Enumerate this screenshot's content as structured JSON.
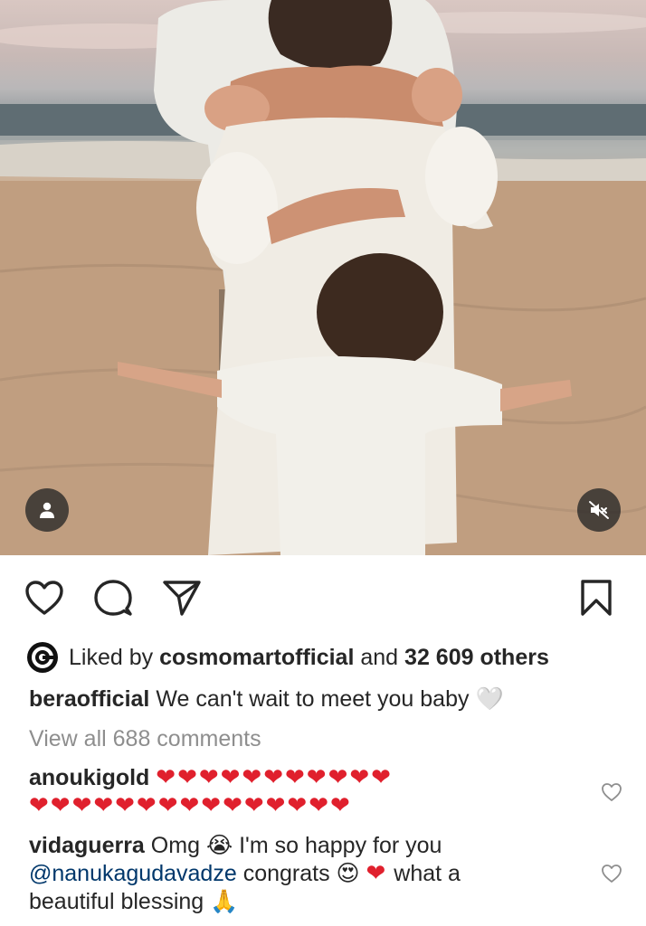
{
  "post": {
    "media_description": "",
    "user_tag_icon": "person-icon",
    "mute_icon": "speaker-muted-icon"
  },
  "actions": {
    "like_icon": "heart-outline-icon",
    "comment_icon": "speech-bubble-icon",
    "share_icon": "paper-plane-icon",
    "save_icon": "bookmark-icon"
  },
  "likes": {
    "prefix": "Liked by",
    "liker": "cosmomartofficial",
    "joiner": "and",
    "others": "32 609 others"
  },
  "caption": {
    "username": "beraofficial",
    "text": "We can't wait to meet you baby",
    "emoji": "🤍"
  },
  "view_all_comments": "View all 688 comments",
  "comments": [
    {
      "username": "anoukigold",
      "line1_hearts": "❤❤❤❤❤❤❤❤❤❤❤",
      "line2_hearts": "❤❤❤❤❤❤❤❤❤❤❤❤❤❤❤"
    },
    {
      "username": "vidaguerra",
      "text1": "Omg",
      "emoji1": "😭",
      "text2": "I'm so happy for you",
      "mention": "@nanukagudavadze",
      "text3": "congrats",
      "emoji2": "😍",
      "emoji3": "❤",
      "text4": "what a",
      "text5": "beautiful blessing",
      "emoji4": "🙏"
    }
  ],
  "colors": {
    "text": "#262626",
    "muted": "#8e8e8e",
    "mention": "#00376b",
    "heart": "#e0202d"
  }
}
